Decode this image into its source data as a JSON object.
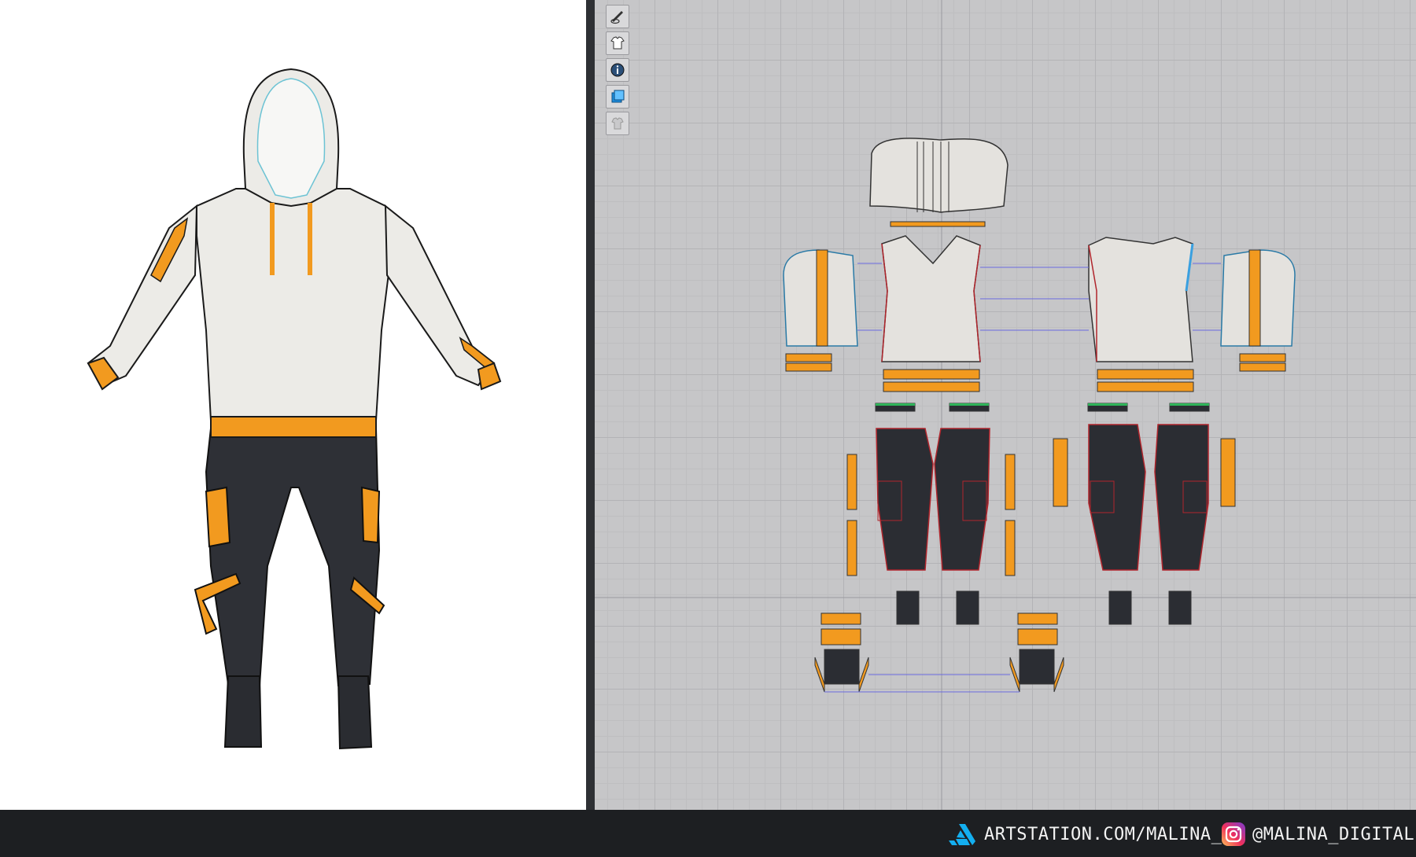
{
  "colors": {
    "hoodie_white": "#ecebe7",
    "accent_orange": "#f29a1f",
    "pants_dark": "#2b2d33",
    "grid_bg": "#c6c6c8",
    "stitch_red": "#b0252c",
    "link_blue": "#6a6ae0",
    "bottom_bar": "#1d1f22"
  },
  "viewport_3d": {
    "subject": "3D avatar wearing white hoodie with orange trims and dark cargo pants"
  },
  "toolbar": {
    "items": [
      {
        "icon": "edit-pattern-eye-icon"
      },
      {
        "icon": "show-garment-icon"
      },
      {
        "icon": "info-icon"
      },
      {
        "icon": "texture-icon"
      },
      {
        "icon": "lock-garment-icon"
      }
    ]
  },
  "footer": {
    "artstation_text": "ARTSTATION.COM/MALINA_A",
    "instagram_text": "@MALINA_DIGITAL"
  }
}
